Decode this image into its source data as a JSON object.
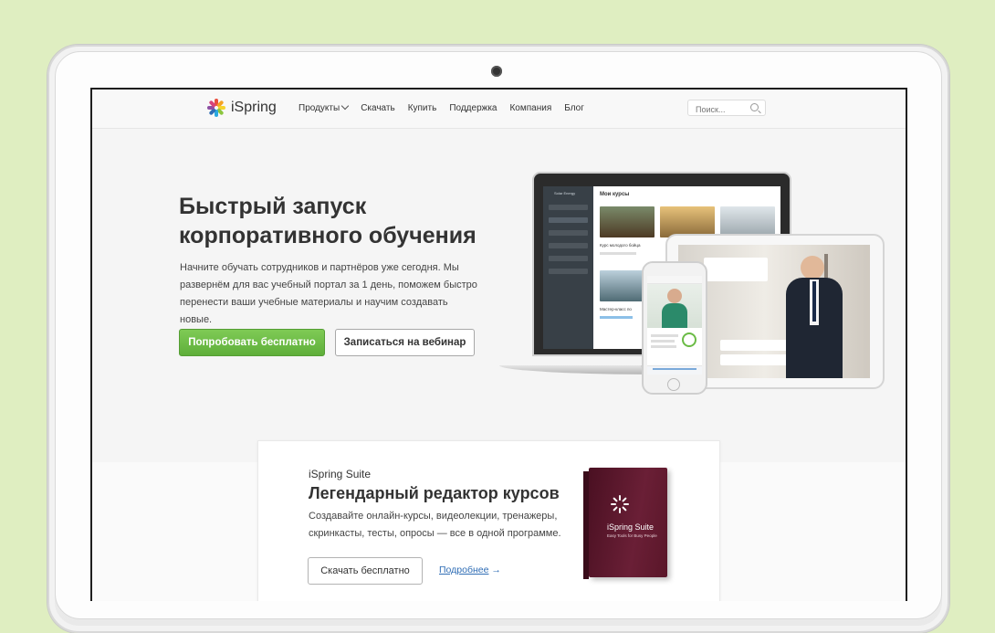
{
  "brand": {
    "name": "iSpring"
  },
  "nav": {
    "items": [
      {
        "label": "Продукты",
        "has_dropdown": true
      },
      {
        "label": "Скачать"
      },
      {
        "label": "Купить"
      },
      {
        "label": "Поддержка"
      },
      {
        "label": "Компания"
      },
      {
        "label": "Блог"
      }
    ],
    "search_placeholder": "Поиск..."
  },
  "hero": {
    "title": "Быстрый запуск корпоративного обучения",
    "subtitle": "Начните обучать сотрудников и партнёров уже сегодня. Мы развернём для вас учебный портал за 1 день, поможем быстро перенести ваши учебные материалы и научим создавать новые.",
    "primary_button": "Попробовать бесплатно",
    "secondary_button": "Записаться на вебинар"
  },
  "mockup": {
    "laptop_header": "Мои курсы",
    "laptop_sidebar_brand": "Solar Energy",
    "course1": "Курс молодого бойца",
    "course2": "Мастер-класс по"
  },
  "suite": {
    "name": "iSpring Suite",
    "title": "Легендарный редактор курсов",
    "description": "Создавайте онлайн-курсы, видеолекции, тренажеры, скринкасты, тесты, опросы — все в одной программе.",
    "download_button": "Скачать бесплатно",
    "more_link": "Подробнее",
    "more_arrow": "→",
    "box_title": "iSpring Suite",
    "box_subtitle": "Easy Tools for Busy People"
  },
  "colors": {
    "background": "#dfeec1",
    "primary_green": "#6abb45",
    "link_blue": "#2f6db5",
    "box_maroon": "#5a1629"
  }
}
